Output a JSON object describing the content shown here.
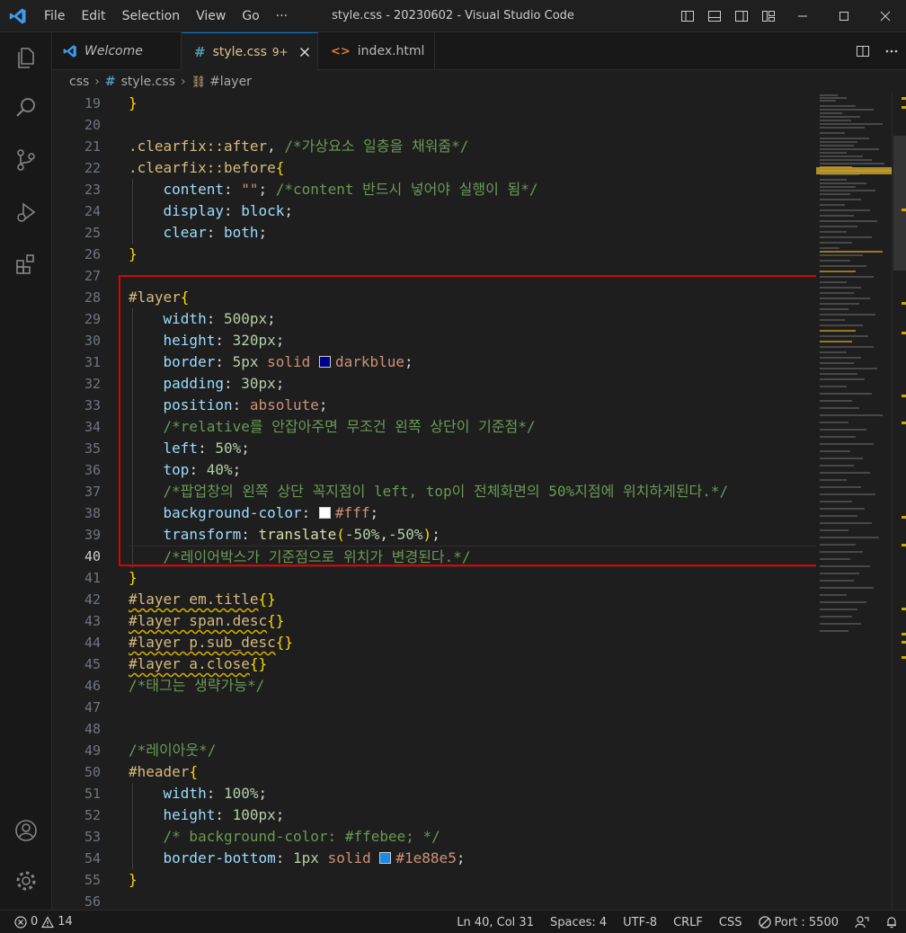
{
  "window": {
    "title": "style.css - 20230602 - Visual Studio Code",
    "menu": [
      "File",
      "Edit",
      "Selection",
      "View",
      "Go",
      "···"
    ]
  },
  "tabs": [
    {
      "label": "Welcome",
      "icon": "vscode-icon",
      "italic": true
    },
    {
      "label": "style.css",
      "badge": "9+",
      "icon": "hash-icon",
      "active": true
    },
    {
      "label": "index.html",
      "icon": "html-icon"
    }
  ],
  "breadcrumb": [
    "css",
    "style.css",
    "#layer"
  ],
  "editor": {
    "lines": [
      {
        "n": "19",
        "tokens": [
          [
            "brace",
            "}"
          ]
        ]
      },
      {
        "n": "20",
        "tokens": []
      },
      {
        "n": "21",
        "tokens": [
          [
            "sel",
            ".clearfix::after"
          ],
          [
            "punct",
            ", "
          ],
          [
            "cmt",
            "/*가상요소 일층을 채워줌*/"
          ]
        ]
      },
      {
        "n": "22",
        "tokens": [
          [
            "sel",
            ".clearfix::before"
          ],
          [
            "brace",
            "{"
          ]
        ]
      },
      {
        "n": "23",
        "tokens": [
          [
            "ws",
            "    "
          ],
          [
            "prop",
            "content"
          ],
          [
            "punct",
            ": "
          ],
          [
            "str",
            "\"\""
          ],
          [
            "punct",
            "; "
          ],
          [
            "cmt",
            "/*content 반드시 넣어야 실행이 됨*/"
          ]
        ]
      },
      {
        "n": "24",
        "tokens": [
          [
            "ws",
            "    "
          ],
          [
            "prop",
            "display"
          ],
          [
            "punct",
            ": "
          ],
          [
            "prop",
            "block"
          ],
          [
            "punct",
            ";"
          ]
        ]
      },
      {
        "n": "25",
        "tokens": [
          [
            "ws",
            "    "
          ],
          [
            "prop",
            "clear"
          ],
          [
            "punct",
            ": "
          ],
          [
            "prop",
            "both"
          ],
          [
            "punct",
            ";"
          ]
        ]
      },
      {
        "n": "26",
        "tokens": [
          [
            "brace",
            "}"
          ]
        ]
      },
      {
        "n": "27",
        "tokens": []
      },
      {
        "n": "28",
        "tokens": [
          [
            "sel",
            "#layer"
          ],
          [
            "brace",
            "{"
          ]
        ]
      },
      {
        "n": "29",
        "tokens": [
          [
            "ws",
            "    "
          ],
          [
            "prop",
            "width"
          ],
          [
            "punct",
            ": "
          ],
          [
            "num",
            "500px"
          ],
          [
            "punct",
            ";"
          ]
        ]
      },
      {
        "n": "30",
        "tokens": [
          [
            "ws",
            "    "
          ],
          [
            "prop",
            "height"
          ],
          [
            "punct",
            ": "
          ],
          [
            "num",
            "320px"
          ],
          [
            "punct",
            ";"
          ]
        ]
      },
      {
        "n": "31",
        "tokens": [
          [
            "ws",
            "    "
          ],
          [
            "prop",
            "border"
          ],
          [
            "punct",
            ": "
          ],
          [
            "num",
            "5px"
          ],
          [
            "punct",
            " "
          ],
          [
            "kw",
            "solid"
          ],
          [
            "punct",
            " "
          ],
          [
            "swatch",
            "#00008b"
          ],
          [
            "kw",
            "darkblue"
          ],
          [
            "punct",
            ";"
          ]
        ]
      },
      {
        "n": "32",
        "tokens": [
          [
            "ws",
            "    "
          ],
          [
            "prop",
            "padding"
          ],
          [
            "punct",
            ": "
          ],
          [
            "num",
            "30px"
          ],
          [
            "punct",
            ";"
          ]
        ]
      },
      {
        "n": "33",
        "tokens": [
          [
            "ws",
            "    "
          ],
          [
            "prop",
            "position"
          ],
          [
            "punct",
            ": "
          ],
          [
            "kw",
            "absolute"
          ],
          [
            "punct",
            ";"
          ]
        ]
      },
      {
        "n": "34",
        "tokens": [
          [
            "ws",
            "    "
          ],
          [
            "cmt",
            "/*relative를 안잡아주면 무조건 왼쪽 상단이 기준점*/"
          ]
        ]
      },
      {
        "n": "35",
        "tokens": [
          [
            "ws",
            "    "
          ],
          [
            "prop",
            "left"
          ],
          [
            "punct",
            ": "
          ],
          [
            "num",
            "50%"
          ],
          [
            "punct",
            ";"
          ]
        ]
      },
      {
        "n": "36",
        "tokens": [
          [
            "ws",
            "    "
          ],
          [
            "prop",
            "top"
          ],
          [
            "punct",
            ": "
          ],
          [
            "num",
            "40%"
          ],
          [
            "punct",
            ";"
          ]
        ]
      },
      {
        "n": "37",
        "tokens": [
          [
            "ws",
            "    "
          ],
          [
            "cmt",
            "/*팝업창의 왼쪽 상단 꼭지점이 left, top이 전체화면의 50%지점에 위치하게된다.*/"
          ]
        ]
      },
      {
        "n": "38",
        "tokens": [
          [
            "ws",
            "    "
          ],
          [
            "prop",
            "background-color"
          ],
          [
            "punct",
            ": "
          ],
          [
            "swatch",
            "#ffffff"
          ],
          [
            "kw",
            "#fff"
          ],
          [
            "punct",
            ";"
          ]
        ]
      },
      {
        "n": "39",
        "tokens": [
          [
            "ws",
            "    "
          ],
          [
            "prop",
            "transform"
          ],
          [
            "punct",
            ": "
          ],
          [
            "fn",
            "translate"
          ],
          [
            "brace",
            "("
          ],
          [
            "num",
            "-50%"
          ],
          [
            "punct",
            ","
          ],
          [
            "num",
            "-50%"
          ],
          [
            "brace",
            ")"
          ],
          [
            "punct",
            ";"
          ]
        ]
      },
      {
        "n": "40",
        "tokens": [
          [
            "ws",
            "    "
          ],
          [
            "cmt",
            "/*레이어박스가 기준점으로 위치가 변경된다.*/"
          ]
        ],
        "current": true
      },
      {
        "n": "41",
        "tokens": [
          [
            "brace",
            "}"
          ]
        ]
      },
      {
        "n": "42",
        "tokens": [
          [
            "selw",
            "#layer em.title"
          ],
          [
            "brace",
            "{}"
          ]
        ]
      },
      {
        "n": "43",
        "tokens": [
          [
            "selw",
            "#layer span.desc"
          ],
          [
            "brace",
            "{}"
          ]
        ]
      },
      {
        "n": "44",
        "tokens": [
          [
            "selw",
            "#layer p.sub_desc"
          ],
          [
            "brace",
            "{}"
          ]
        ]
      },
      {
        "n": "45",
        "tokens": [
          [
            "selw",
            "#layer a.close"
          ],
          [
            "brace",
            "{}"
          ]
        ]
      },
      {
        "n": "46",
        "tokens": [
          [
            "cmt",
            "/*태그는 생략가능*/"
          ]
        ]
      },
      {
        "n": "47",
        "tokens": []
      },
      {
        "n": "48",
        "tokens": []
      },
      {
        "n": "49",
        "tokens": [
          [
            "cmt",
            "/*레이아웃*/"
          ]
        ]
      },
      {
        "n": "50",
        "tokens": [
          [
            "sel",
            "#header"
          ],
          [
            "brace",
            "{"
          ]
        ]
      },
      {
        "n": "51",
        "tokens": [
          [
            "ws",
            "    "
          ],
          [
            "prop",
            "width"
          ],
          [
            "punct",
            ": "
          ],
          [
            "num",
            "100%"
          ],
          [
            "punct",
            ";"
          ]
        ]
      },
      {
        "n": "52",
        "tokens": [
          [
            "ws",
            "    "
          ],
          [
            "prop",
            "height"
          ],
          [
            "punct",
            ": "
          ],
          [
            "num",
            "100px"
          ],
          [
            "punct",
            ";"
          ]
        ]
      },
      {
        "n": "53",
        "tokens": [
          [
            "ws",
            "    "
          ],
          [
            "cmt",
            "/* background-color: #ffebee; */"
          ]
        ]
      },
      {
        "n": "54",
        "tokens": [
          [
            "ws",
            "    "
          ],
          [
            "prop",
            "border-bottom"
          ],
          [
            "punct",
            ": "
          ],
          [
            "num",
            "1px"
          ],
          [
            "punct",
            " "
          ],
          [
            "kw",
            "solid"
          ],
          [
            "punct",
            " "
          ],
          [
            "swatch",
            "#1e88e5"
          ],
          [
            "kw",
            "#1e88e5"
          ],
          [
            "punct",
            ";"
          ]
        ]
      },
      {
        "n": "55",
        "tokens": [
          [
            "brace",
            "}"
          ]
        ]
      },
      {
        "n": "56",
        "tokens": []
      }
    ]
  },
  "statusbar": {
    "errors": "0",
    "warnings": "14",
    "position": "Ln 40, Col 31",
    "spaces": "Spaces: 4",
    "encoding": "UTF-8",
    "eol": "CRLF",
    "language": "CSS",
    "port": "Port : 5500"
  },
  "colors": {
    "accent": "#0078d4",
    "highlight": "#e00000",
    "warning": "#cca700",
    "active_tab_text": "#e2c08d"
  }
}
